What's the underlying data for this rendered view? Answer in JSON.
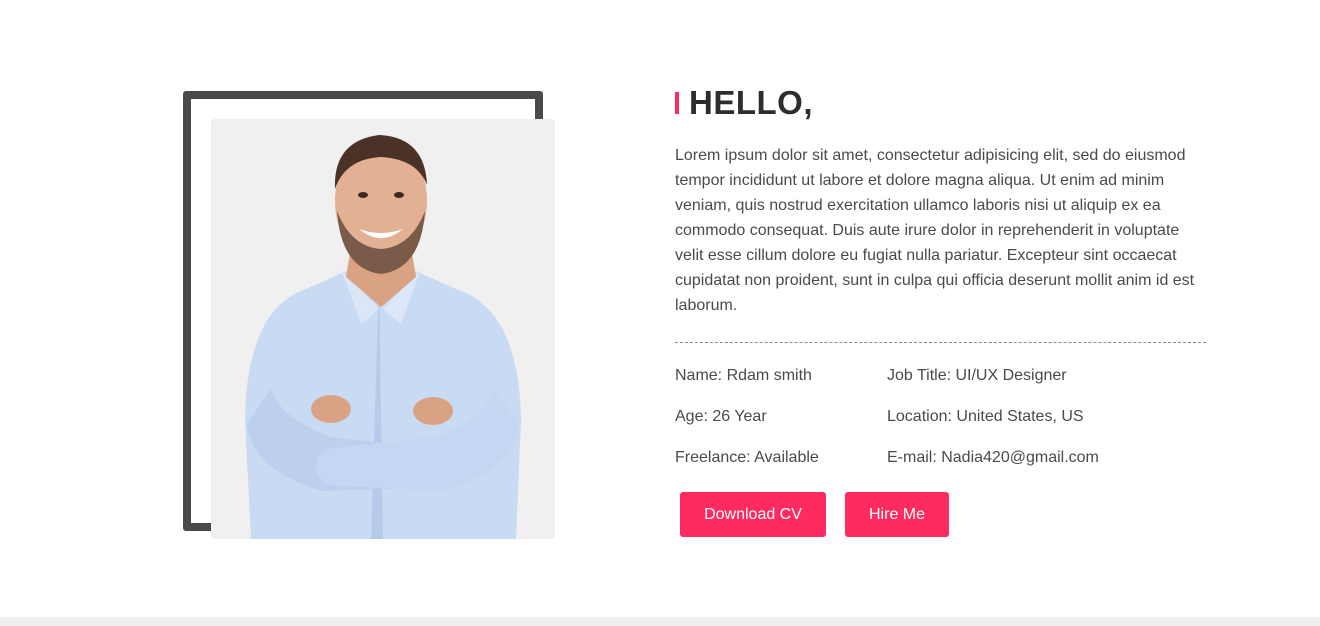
{
  "about": {
    "heading": "HELLO,",
    "bio": "Lorem ipsum dolor sit amet, consectetur adipisicing elit, sed do eiusmod tempor incididunt ut labore et dolore magna aliqua. Ut enim ad minim veniam, quis nostrud exercitation ullamco laboris nisi ut aliquip ex ea commodo consequat. Duis aute irure dolor in reprehenderit in voluptate velit esse cillum dolore eu fugiat nulla pariatur. Excepteur sint occaecat cupidatat non proident, sunt in culpa qui officia deserunt mollit anim id est laborum.",
    "details": {
      "name": "Name: Rdam smith",
      "job_title": "Job Title: UI/UX Designer",
      "age": "Age: 26 Year",
      "location": "Location: United States, US",
      "freelance": "Freelance: Available",
      "email": "E-mail: Nadia420@gmail.com"
    },
    "buttons": {
      "download_cv": "Download CV",
      "hire_me": "Hire Me"
    }
  },
  "colors": {
    "accent": "#ff2a5f",
    "frame": "#4a4a4a",
    "text": "#4a4a4a",
    "heading": "#2d2d2d",
    "photo_bg": "#f0f0f0"
  }
}
